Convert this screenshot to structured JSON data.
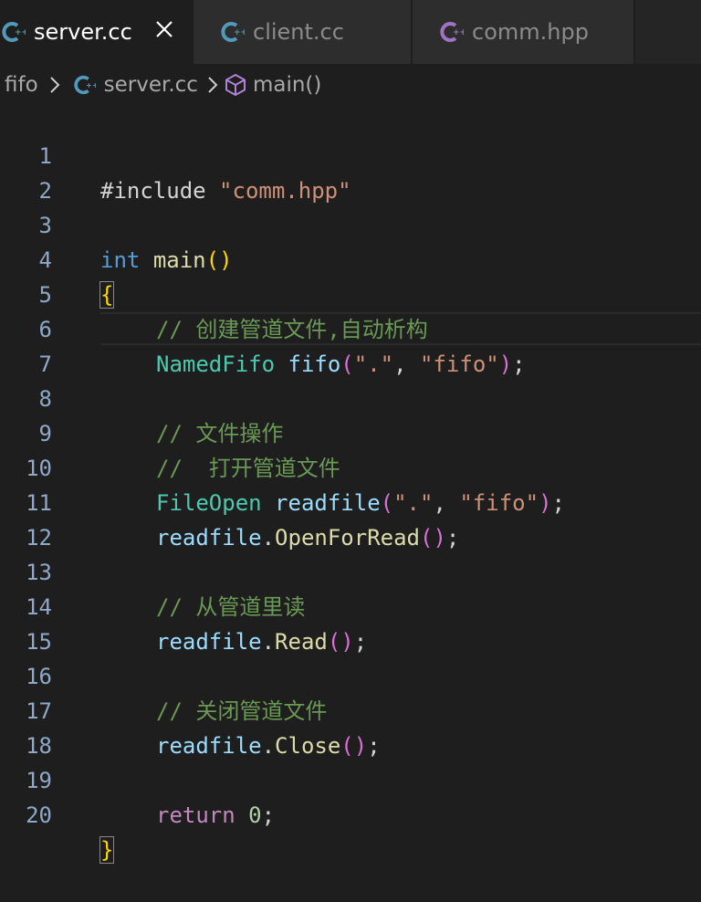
{
  "tabs": [
    {
      "label": "server.cc",
      "active": true
    },
    {
      "label": "client.cc",
      "active": false
    },
    {
      "label": "comm.hpp",
      "active": false
    }
  ],
  "breadcrumb": {
    "folder": "fifo",
    "file": "server.cc",
    "symbol": "main()"
  },
  "icons": {
    "file_icon": "c-plus-plus-icon",
    "close": "close-icon",
    "symbol": "cube-icon"
  },
  "colors": {
    "cpp_icon": "#a074c4",
    "cpp_icon_active": "#519aba"
  },
  "line_numbers": [
    "1",
    "2",
    "3",
    "4",
    "5",
    "6",
    "7",
    "8",
    "9",
    "10",
    "11",
    "12",
    "13",
    "14",
    "15",
    "16",
    "17",
    "18",
    "19",
    "20"
  ],
  "code": {
    "l1_pre": "#include",
    "l1_str": "\"comm.hpp\"",
    "l3_type": "int",
    "l3_fn": "main",
    "l3_open": "(",
    "l3_close": ")",
    "l4": "{",
    "l5": "// 创建管道文件,自动析构",
    "l6_type": "NamedFifo",
    "l6_var": "fifo",
    "l6_open": "(",
    "l6_s1": "\".\"",
    "l6_comma": ", ",
    "l6_s2": "\"fifo\"",
    "l6_close": ")",
    "l6_semi": ";",
    "l8": "// 文件操作",
    "l9": "//  打开管道文件",
    "l10_type": "FileOpen",
    "l10_var": "readfile",
    "l10_open": "(",
    "l10_s1": "\".\"",
    "l10_comma": ", ",
    "l10_s2": "\"fifo\"",
    "l10_close": ")",
    "l10_semi": ";",
    "l11_var": "readfile",
    "l11_dot": ".",
    "l11_fn": "OpenForRead",
    "l11_paren": "()",
    "l11_semi": ";",
    "l13": "// 从管道里读",
    "l14_var": "readfile",
    "l14_dot": ".",
    "l14_fn": "Read",
    "l14_paren": "()",
    "l14_semi": ";",
    "l16": "// 关闭管道文件",
    "l17_var": "readfile",
    "l17_dot": ".",
    "l17_fn": "Close",
    "l17_paren": "()",
    "l17_semi": ";",
    "l19_kw": "return",
    "l19_num": "0",
    "l19_semi": ";",
    "l20": "}"
  }
}
